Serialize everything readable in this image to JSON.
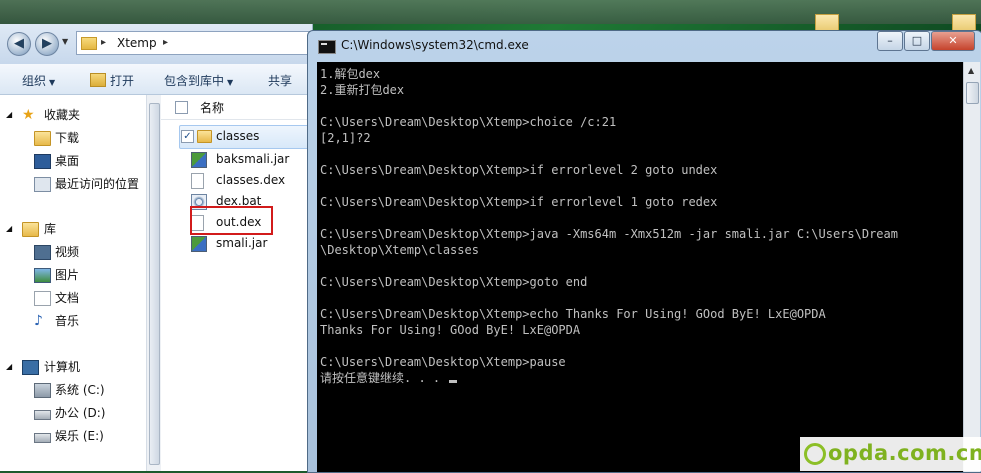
{
  "explorer": {
    "path_segments": [
      "Xtemp"
    ],
    "toolbar": {
      "organize": "组织",
      "open": "打开",
      "include": "包含到库中",
      "share": "共享"
    },
    "nav": {
      "favorites": "收藏夹",
      "downloads": "下载",
      "desktop": "桌面",
      "recent": "最近访问的位置",
      "libraries": "库",
      "videos": "视频",
      "pictures": "图片",
      "documents": "文档",
      "music": "音乐",
      "computer": "计算机",
      "drive_c": "系统 (C:)",
      "drive_d": "办公 (D:)",
      "drive_e": "娱乐 (E:)"
    },
    "column_name": "名称",
    "files": [
      {
        "name": "classes",
        "icon": "folder-icon"
      },
      {
        "name": "baksmali.jar",
        "icon": "jar-icon"
      },
      {
        "name": "classes.dex",
        "icon": "file-icon"
      },
      {
        "name": "dex.bat",
        "icon": "batch-file-icon"
      },
      {
        "name": "out.dex",
        "icon": "file-icon"
      },
      {
        "name": "smali.jar",
        "icon": "jar-icon"
      }
    ]
  },
  "cmd": {
    "title": "C:\\Windows\\system32\\cmd.exe",
    "buttons": {
      "minimize": "–",
      "maximize": "□",
      "close": "✕"
    },
    "lines": [
      "1.解包dex",
      "2.重新打包dex",
      "",
      "C:\\Users\\Dream\\Desktop\\Xtemp>choice /c:21",
      "[2,1]?2",
      "",
      "C:\\Users\\Dream\\Desktop\\Xtemp>if errorlevel 2 goto undex",
      "",
      "C:\\Users\\Dream\\Desktop\\Xtemp>if errorlevel 1 goto redex",
      "",
      "C:\\Users\\Dream\\Desktop\\Xtemp>java -Xms64m -Xmx512m -jar smali.jar C:\\Users\\Dream",
      "\\Desktop\\Xtemp\\classes",
      "",
      "C:\\Users\\Dream\\Desktop\\Xtemp>goto end",
      "",
      "C:\\Users\\Dream\\Desktop\\Xtemp>echo Thanks For Using! GOod ByE! LxE@OPDA",
      "Thanks For Using! GOod ByE! LxE@OPDA",
      "",
      "C:\\Users\\Dream\\Desktop\\Xtemp>pause",
      "请按任意键继续. . . "
    ]
  },
  "watermark": "opda.com.cn"
}
